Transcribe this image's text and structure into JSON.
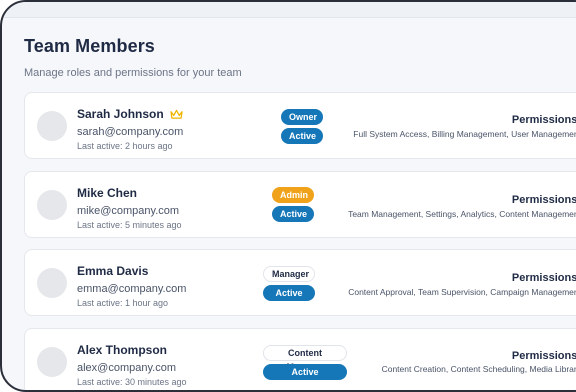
{
  "page": {
    "title": "Team Members",
    "subtitle": "Manage roles and permissions for your team",
    "permissions_label": "Permissions:"
  },
  "members": [
    {
      "name": "Sarah Johnson",
      "email": "sarah@company.com",
      "last_active": "Last active: 2 hours ago",
      "role": "Owner",
      "status": "Active",
      "permissions": "Full System Access, Billing Management, User Management",
      "crown": "crown-icon"
    },
    {
      "name": "Mike Chen",
      "email": "mike@company.com",
      "last_active": "Last active: 5 minutes ago",
      "role": "Admin",
      "status": "Active",
      "permissions": "Team Management, Settings, Analytics, Content Management"
    },
    {
      "name": "Emma Davis",
      "email": "emma@company.com",
      "last_active": "Last active: 1 hour ago",
      "role": "Manager",
      "status": "Active",
      "permissions": "Content Approval, Team Supervision, Campaign Management"
    },
    {
      "name": "Alex Thompson",
      "email": "alex@company.com",
      "last_active": "Last active: 30 minutes ago",
      "role": "Content Manager",
      "status": "Active",
      "permissions": "Content Creation, Content Scheduling, Media Library"
    }
  ],
  "colors": {
    "owner": "#1677b8",
    "admin": "#f0a21a",
    "active": "#1677b8",
    "crown": "#f0b400"
  }
}
